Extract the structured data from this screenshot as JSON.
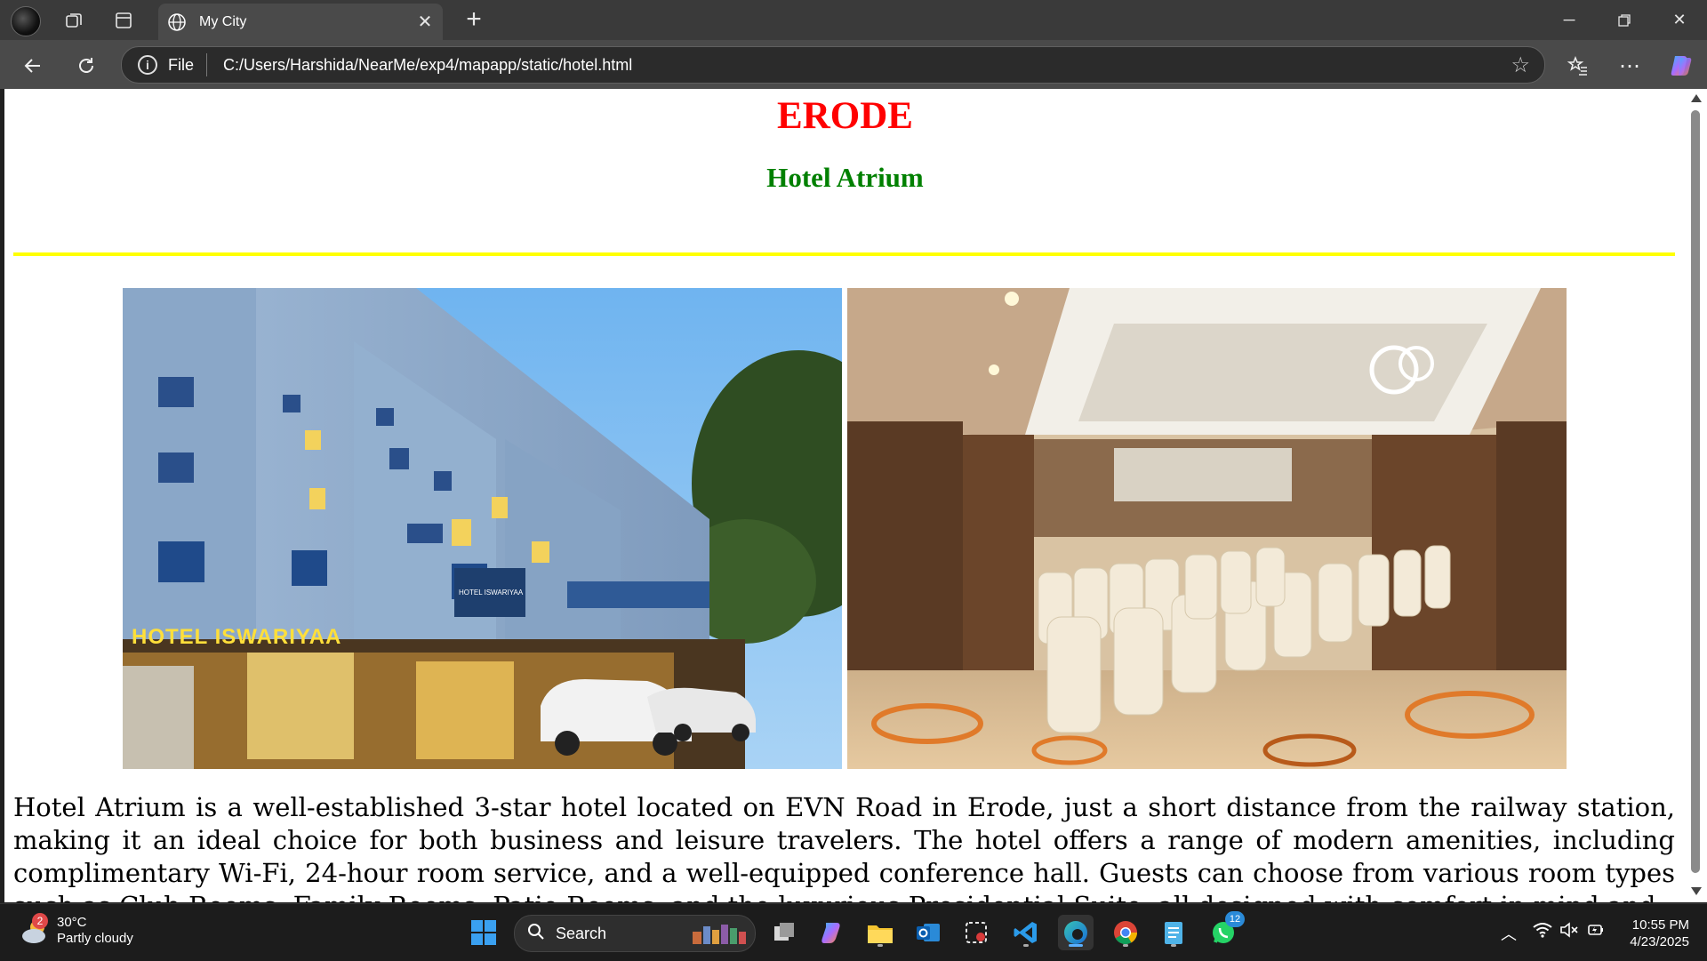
{
  "browser": {
    "tab_title": "My City",
    "address_scheme": "File",
    "address_url": "C:/Users/Harshida/NearMe/exp4/mapapp/static/hotel.html"
  },
  "page": {
    "heading": "ERODE",
    "hotel_name": "Hotel Atrium",
    "description": "Hotel Atrium is a well-established 3-star hotel located on EVN Road in Erode, just a short distance from the railway station, making it an ideal choice for both business and leisure travelers. The hotel offers a range of modern amenities, including complimentary Wi-Fi, 24-hour room service, and a well-equipped conference hall. Guests can choose from various room types such as Club Rooms, Family Rooms, Patio Rooms, and the luxurious Presidential Suite, all designed with comfort in mind and",
    "image_left_sign": "HOTEL ISWARIYAA",
    "image_left_sign_small": "HOTEL ISWARIYAA",
    "colors": {
      "heading": "#ff0000",
      "hotel_name": "#008000",
      "rule": "#ffff00"
    }
  },
  "taskbar": {
    "weather_temp": "30°C",
    "weather_desc": "Partly cloudy",
    "weather_badge": "2",
    "search_label": "Search",
    "whatsapp_badge": "12",
    "time": "10:55 PM",
    "date": "4/23/2025",
    "icons": [
      "start-icon",
      "search-icon",
      "task-view-icon",
      "copilot-icon",
      "file-explorer-icon",
      "outlook-icon",
      "snipping-tool-icon",
      "vscode-icon",
      "edge-icon",
      "chrome-icon",
      "notepad-icon",
      "whatsapp-icon"
    ]
  }
}
